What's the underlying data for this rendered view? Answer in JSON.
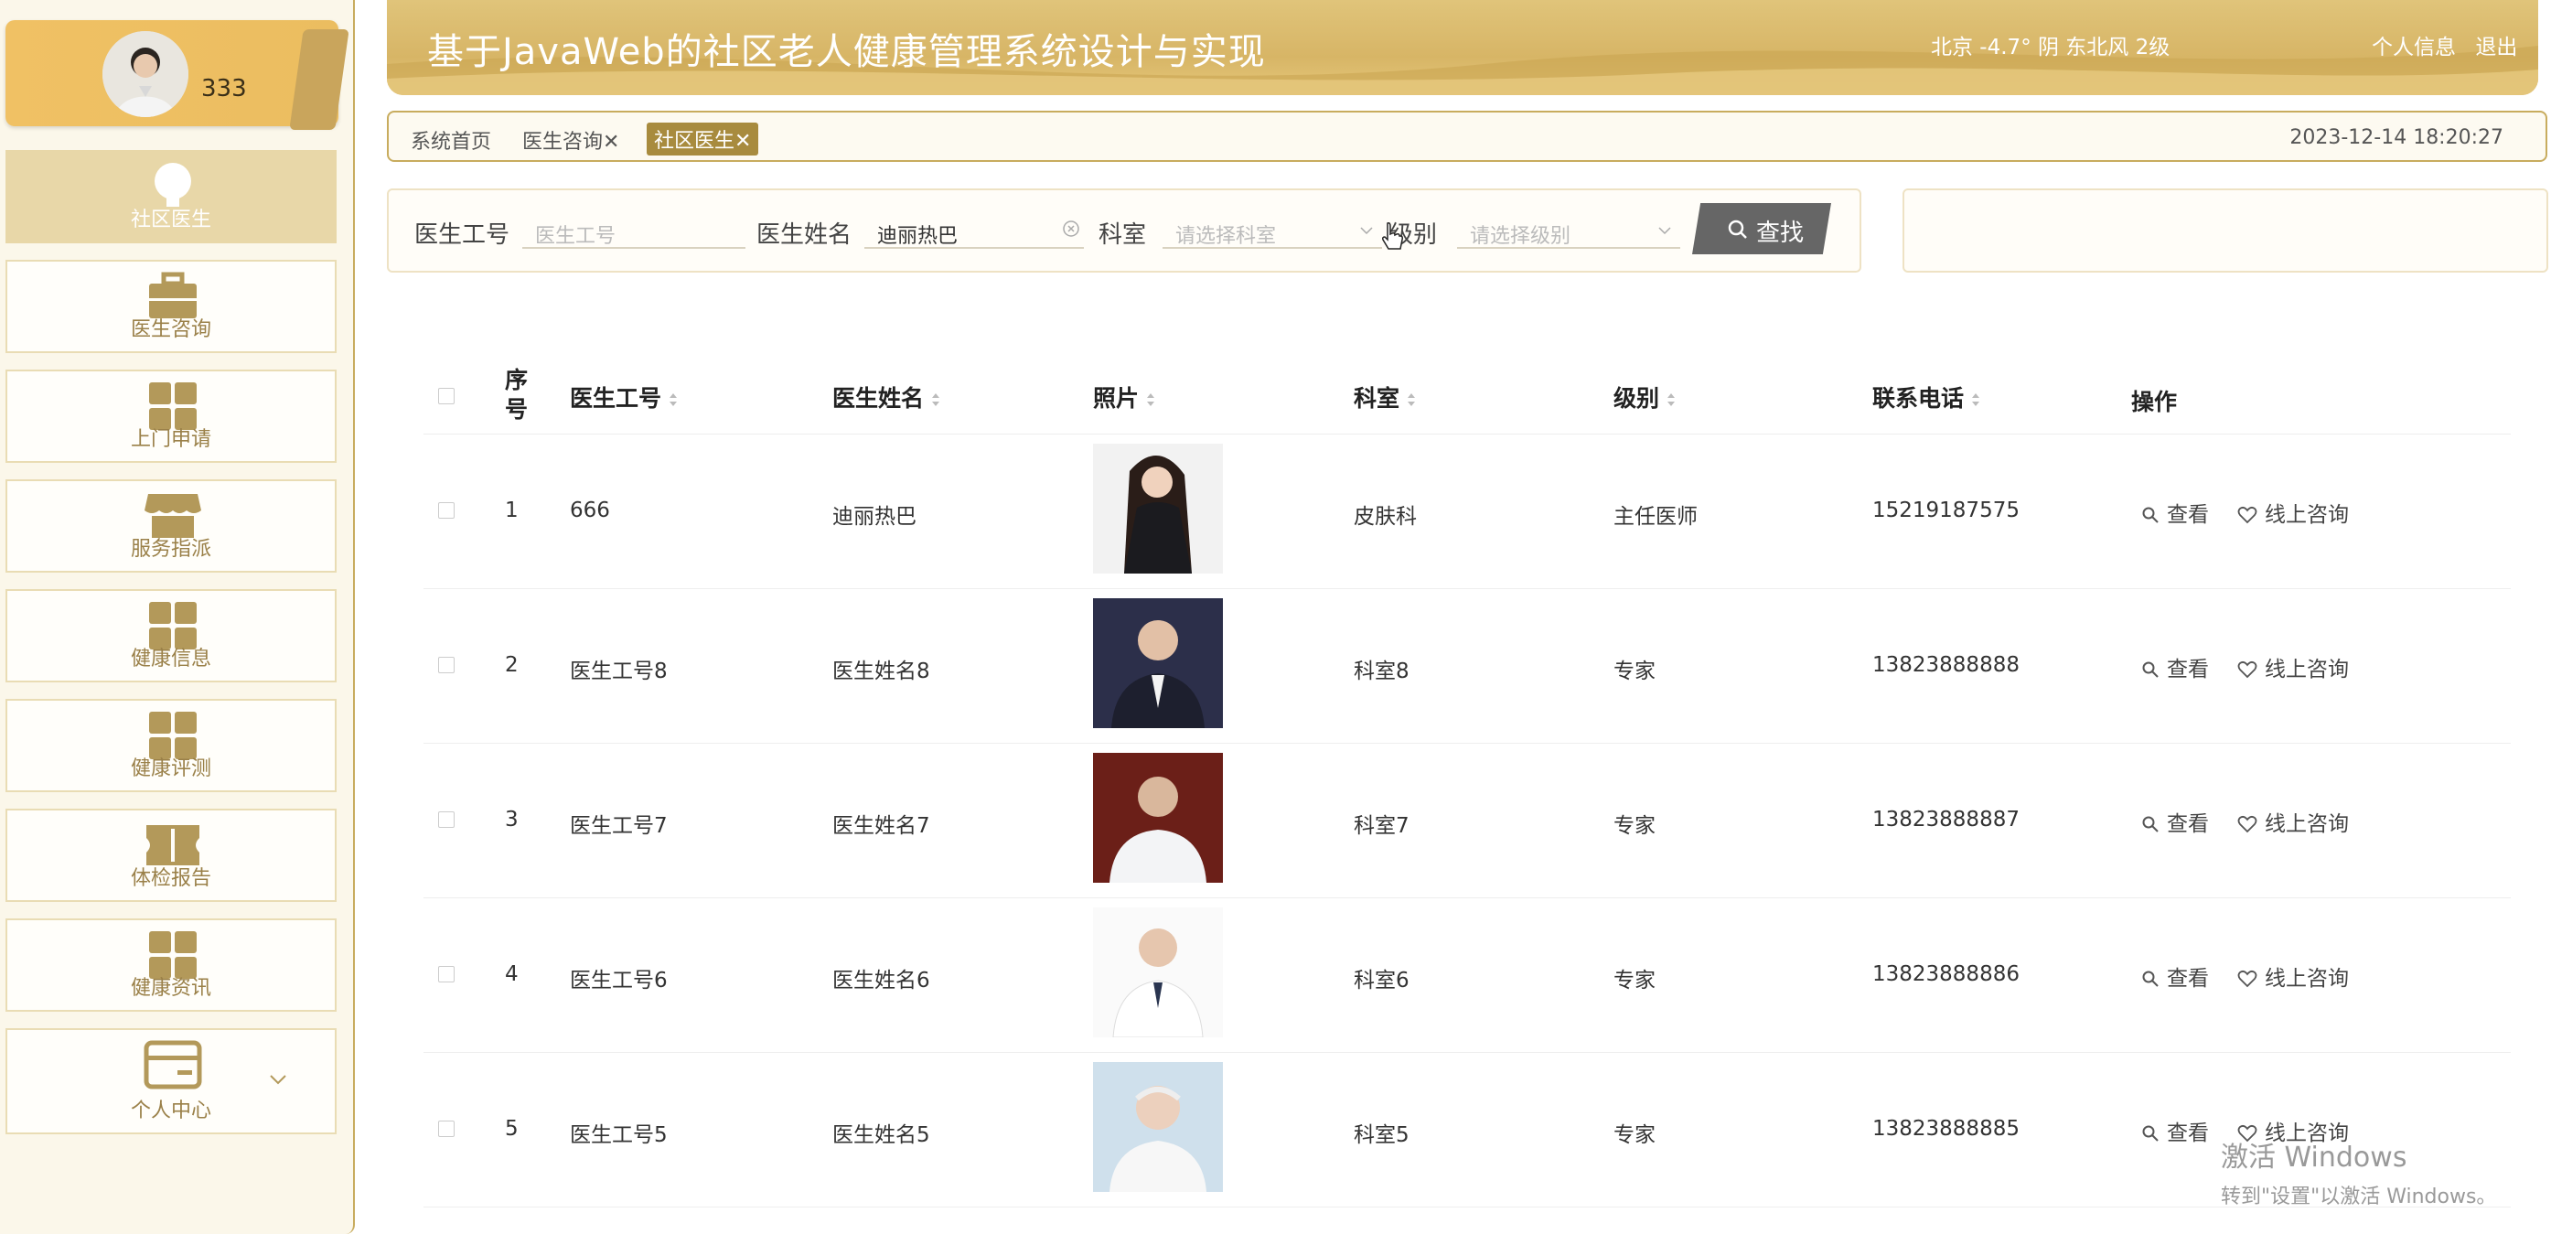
{
  "user": {
    "name": "333"
  },
  "sidebar": {
    "items": [
      {
        "label": "社区医生",
        "icon": "bulb-icon",
        "active": true
      },
      {
        "label": "医生咨询",
        "icon": "briefcase-icon"
      },
      {
        "label": "上门申请",
        "icon": "grid-icon"
      },
      {
        "label": "服务指派",
        "icon": "store-icon"
      },
      {
        "label": "健康信息",
        "icon": "grid-icon"
      },
      {
        "label": "健康评测",
        "icon": "grid-icon"
      },
      {
        "label": "体检报告",
        "icon": "ticket-icon"
      },
      {
        "label": "健康资讯",
        "icon": "grid-icon"
      },
      {
        "label": "个人中心",
        "icon": "card-icon"
      }
    ]
  },
  "header": {
    "title": "基于JavaWeb的社区老人健康管理系统设计与实现",
    "weather": "北京  -4.7°  阴  东北风  2级",
    "profile_link": "个人信息",
    "logout_link": "退出"
  },
  "tags": {
    "items": [
      {
        "label": "系统首页"
      },
      {
        "label": "医生咨询",
        "closable": true
      },
      {
        "label": "社区医生",
        "closable": true,
        "active": true
      }
    ],
    "datetime": "2023-12-14 18:20:27"
  },
  "search": {
    "id_label": "医生工号",
    "id_placeholder": "医生工号",
    "name_label": "医生姓名",
    "name_value": "迪丽热巴",
    "dept_label": "科室",
    "dept_placeholder": "请选择科室",
    "level_label": "级别",
    "level_placeholder": "请选择级别",
    "find_label": "查找"
  },
  "table": {
    "columns": [
      "序号",
      "医生工号",
      "医生姓名",
      "照片",
      "科室",
      "级别",
      "联系电话",
      "操作"
    ],
    "rows": [
      {
        "no": "1",
        "id": "666",
        "name": "迪丽热巴",
        "dept": "皮肤科",
        "level": "主任医师",
        "phone": "15219187575"
      },
      {
        "no": "2",
        "id": "医生工号8",
        "name": "医生姓名8",
        "dept": "科室8",
        "level": "专家",
        "phone": "13823888888"
      },
      {
        "no": "3",
        "id": "医生工号7",
        "name": "医生姓名7",
        "dept": "科室7",
        "level": "专家",
        "phone": "13823888887"
      },
      {
        "no": "4",
        "id": "医生工号6",
        "name": "医生姓名6",
        "dept": "科室6",
        "level": "专家",
        "phone": "13823888886"
      },
      {
        "no": "5",
        "id": "医生工号5",
        "name": "医生姓名5",
        "dept": "科室5",
        "level": "专家",
        "phone": "13823888885"
      }
    ],
    "actions": {
      "view": "查看",
      "consult": "线上咨询"
    }
  },
  "watermark": {
    "line1": "激活 Windows",
    "line2": "转到\"设置\"以激活 Windows。"
  },
  "colors": {
    "gold": "#d7b566",
    "accent": "#a88b3e",
    "menu_active": "#e8d7a8"
  }
}
